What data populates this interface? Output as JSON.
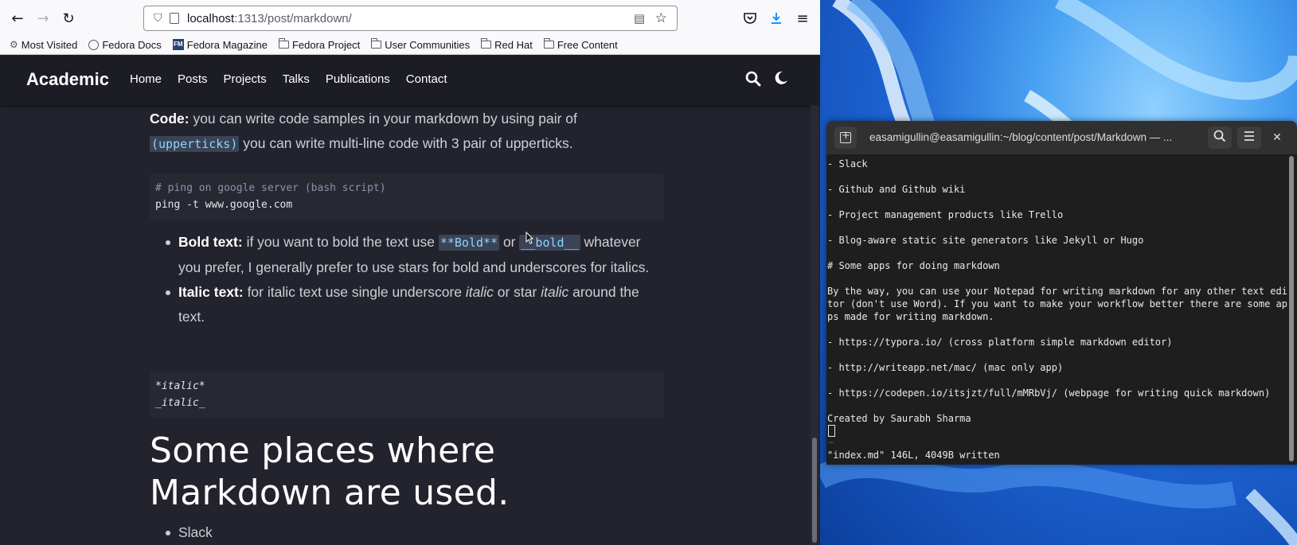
{
  "browser": {
    "url_host": "localhost",
    "url_rest": ":1313/post/markdown/",
    "bookmarks": [
      "Most Visited",
      "Fedora Docs",
      "Fedora Magazine",
      "Fedora Project",
      "User Communities",
      "Red Hat",
      "Free Content"
    ]
  },
  "site": {
    "brand": "Academic",
    "nav": [
      "Home",
      "Posts",
      "Projects",
      "Talks",
      "Publications",
      "Contact"
    ]
  },
  "article": {
    "code_label": "Code:",
    "code_text_1": " you can write code samples in your markdown by using pair of",
    "code_inline": "(upperticks)",
    "code_text_2": " you can write multi-line code with 3 pair of upperticks.",
    "codeblock1_comment": "# ping on google server (bash script)",
    "codeblock1_line": "ping -t www.google.com",
    "bold_label": "Bold text:",
    "bold_text_1": " if you want to bold the text use ",
    "bold_code_1": "**Bold**",
    "bold_or": " or ",
    "bold_code_2": "__bold__",
    "bold_text_2": "whatever you prefer, I generally prefer to use stars for bold and underscores for italics.",
    "italic_label": "Italic text:",
    "italic_text_1": " for italic text use single underscore ",
    "italic_word_1": "italic",
    "italic_text_2": " or star ",
    "italic_word_2": "italic",
    "italic_text_3": " around the text.",
    "codeblock2_line1": "*italic*",
    "codeblock2_line2": "_italic_",
    "heading": "Some places where Markdown are used.",
    "list_item": "Slack"
  },
  "terminal": {
    "title": "easamigullin@easamigullin:~/blog/content/post/Markdown — ...",
    "lines": [
      "- Slack",
      "",
      "- Github and Github wiki",
      "",
      "- Project management products like Trello",
      "",
      "- Blog-aware static site generators like Jekyll or Hugo",
      "",
      "# Some apps for doing markdown",
      "",
      "By the way, you can use your Notepad for writing markdown for any other text edi",
      "tor (don't use Word). If you want to make your workflow better there are some ap",
      "ps made for writing markdown.",
      "",
      "- https://typora.io/ (cross platform simple markdown editor)",
      "",
      "- http://writeapp.net/mac/ (mac only app)",
      "",
      "- https://codepen.io/itsjzt/full/mMRbVj/ (webpage for writing quick markdown)",
      "",
      "Created by Saurabh Sharma"
    ],
    "tilde": "~",
    "status": "\"index.md\" 146L, 4049B written"
  },
  "icons": {
    "back": "back-arrow-icon",
    "forward": "forward-arrow-icon",
    "reload": "reload-icon",
    "shield": "shield-icon",
    "page": "page-icon",
    "reader": "reader-view-icon",
    "bookmark_star": "bookmark-star-icon",
    "pocket": "pocket-icon",
    "download": "download-icon",
    "menu": "hamburger-menu-icon",
    "search": "search-icon",
    "theme": "moon-icon",
    "terminal_new_tab": "new-tab-icon",
    "terminal_search": "search-icon",
    "terminal_menu": "hamburger-menu-icon",
    "terminal_close": "close-icon"
  },
  "colors": {
    "site_bg": "#23232d",
    "inline_code": "#8ed4ff",
    "terminal_bg": "#1e1e1e",
    "download_accent": "#0a84ff"
  }
}
